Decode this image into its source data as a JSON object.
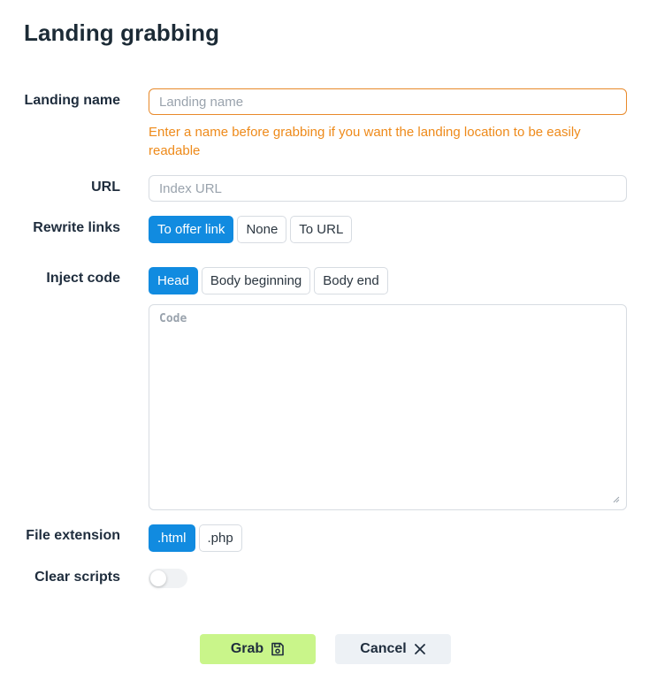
{
  "page": {
    "title": "Landing grabbing"
  },
  "form": {
    "landing_name": {
      "label": "Landing name",
      "placeholder": "Landing name",
      "value": "",
      "hint": "Enter a name before grabbing if you want the landing location to be easily readable"
    },
    "url": {
      "label": "URL",
      "placeholder": "Index URL",
      "value": ""
    },
    "rewrite_links": {
      "label": "Rewrite links",
      "options": [
        "To offer link",
        "None",
        "To URL"
      ],
      "selected": "To offer link"
    },
    "inject_code": {
      "label": "Inject code",
      "options": [
        "Head",
        "Body beginning",
        "Body end"
      ],
      "selected": "Head",
      "code_placeholder": "Code",
      "code_value": ""
    },
    "file_extension": {
      "label": "File extension",
      "options": [
        ".html",
        ".php"
      ],
      "selected": ".html"
    },
    "clear_scripts": {
      "label": "Clear scripts",
      "enabled": false
    }
  },
  "actions": {
    "grab_label": "Grab",
    "grab_icon": "save-icon",
    "cancel_label": "Cancel",
    "cancel_icon": "close-icon"
  },
  "colors": {
    "accent": "#118be0",
    "warning": "#ee8a1a",
    "grab_bg": "#c9f58a",
    "cancel_bg": "#edf1f5"
  }
}
